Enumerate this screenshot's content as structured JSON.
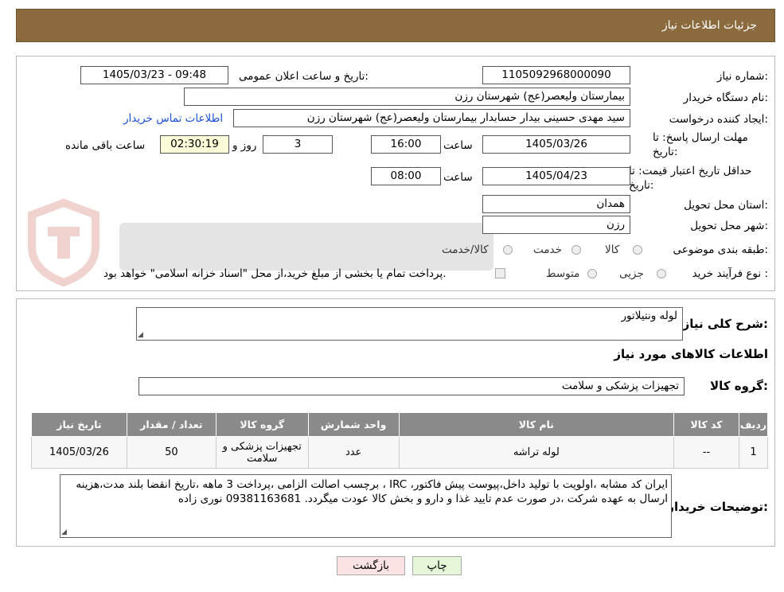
{
  "header": {
    "title": "جزئیات اطلاعات نیاز"
  },
  "form": {
    "need_number_label": "شماره نیاز:",
    "need_number": "1105092968000090",
    "announce_label": "تاریخ و ساعت اعلان عمومی:",
    "announce_value": "1405/03/23 - 09:48",
    "buyer_org_label": "نام دستگاه خریدار:",
    "buyer_org": "بیمارستان ولیعصر(عج) شهرستان رزن",
    "creator_label": "ایجاد کننده درخواست:",
    "creator": "سید مهدی حسینی بیدار حسابدار بیمارستان ولیعصر(عج) شهرستان رزن",
    "contact_link": "اطلاعات تماس خریدار",
    "deadline_label": "مهلت ارسال پاسخ: تا تاریخ:",
    "deadline_date": "1405/03/26",
    "time_label": "ساعت",
    "deadline_time": "16:00",
    "days_value": "3",
    "days_label": "روز و",
    "remaining_time": "02:30:19",
    "remaining_label": "ساعت باقی مانده",
    "validity_label": "حداقل تاریخ اعتبار قیمت: تا تاریخ:",
    "validity_date": "1405/04/23",
    "validity_time": "08:00",
    "province_label": "استان محل تحویل:",
    "province": "همدان",
    "city_label": "شهر محل تحویل:",
    "city": "رزن",
    "category_label": "طبقه بندی موضوعی:",
    "category_options": [
      "کالا",
      "خدمت",
      "کالا/خدمت"
    ],
    "process_label": "نوع فرآیند خرید :",
    "process_options": [
      "جزیی",
      "متوسط"
    ],
    "payment_note": "پرداخت تمام یا بخشی از مبلغ خرید،از محل \"اسناد خزانه اسلامی\" خواهد بود."
  },
  "details": {
    "description_label": "شرح کلی نیاز:",
    "description": "لوله ونتیلاتور",
    "goods_info_title": "اطلاعات کالاهای مورد نیاز",
    "group_label": "گروه کالا:",
    "group_value": "تجهیزات پزشکی و سلامت",
    "table": {
      "headers": [
        "ردیف",
        "کد کالا",
        "نام کالا",
        "واحد شمارش",
        "گروه کالا",
        "تعداد / مقدار",
        "تاریخ نیاز"
      ],
      "rows": [
        [
          "1",
          "--",
          "لوله تراشه",
          "عدد",
          "تجهیزات پزشکی و سلامت",
          "50",
          "1405/03/26"
        ]
      ]
    },
    "buyer_notes_label": "توضیحات خریدار:",
    "buyer_notes": "ایران کد مشابه ،اولویت با تولید داخل،پیوست پیش فاکتور، IRC ، برچسب اصالت الزامی ،پرداخت 3 ماهه ،تاریخ انقضا بلند مدت،هزینه ارسال به عهده شرکت ،در صورت عدم تایید غذا و دارو و بخش کالا عودت میگردد. 09381163681 نوری زاده"
  },
  "buttons": {
    "print": "چاپ",
    "back": "بازگشت"
  },
  "colors": {
    "header_bg": "#8b6b3d",
    "link": "#1a4fd6",
    "table_header_bg": "#8a8a8a",
    "back_btn_bg": "#fbe3e3",
    "print_btn_bg": "#e6f6d9"
  }
}
